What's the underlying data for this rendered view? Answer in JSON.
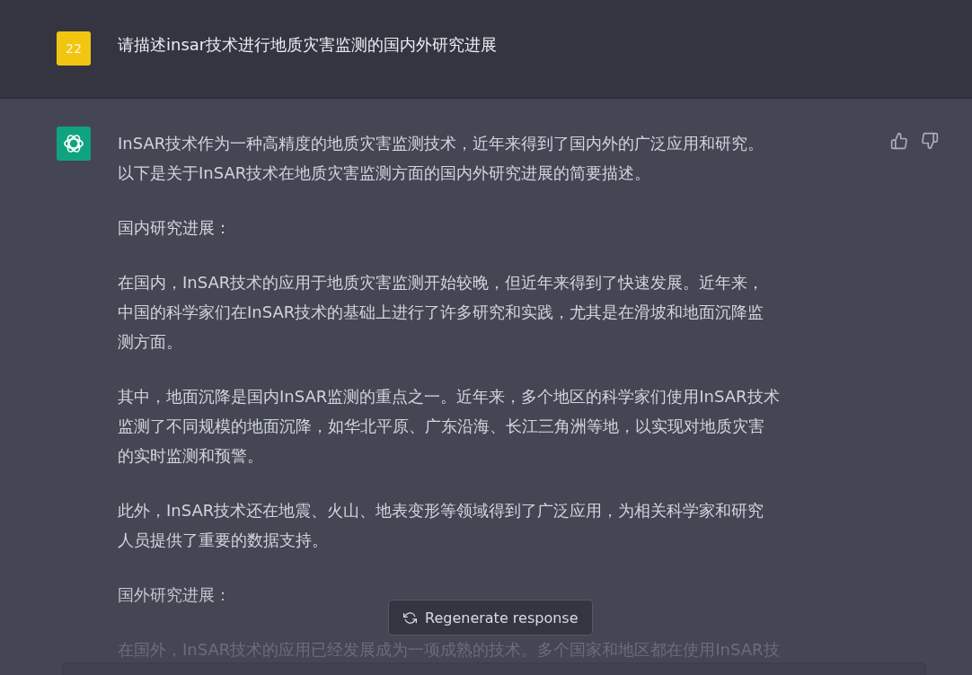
{
  "question": {
    "avatar": "22",
    "text": "请描述insar技术进行地质灾害监测的国内外研究进展"
  },
  "answer": {
    "paragraphs": [
      {
        "lines": [
          "InSAR技术作为一种高精度的地质灾害监测技术，近年来得到了国内外的广泛应用和研究。",
          "以下是关于InSAR技术在地质灾害监测方面的国内外研究进展的简要描述。"
        ],
        "faded": false
      },
      {
        "lines": [
          "国内研究进展："
        ],
        "faded": false
      },
      {
        "lines": [
          "在国内，InSAR技术的应用于地质灾害监测开始较晚，但近年来得到了快速发展。近年来，",
          "中国的科学家们在InSAR技术的基础上进行了许多研究和实践，尤其是在滑坡和地面沉降监",
          "测方面。"
        ],
        "faded": false
      },
      {
        "lines": [
          "其中，地面沉降是国内InSAR监测的重点之一。近年来，多个地区的科学家们使用InSAR技术",
          "监测了不同规模的地面沉降，如华北平原、广东沿海、长江三角洲等地，以实现对地质灾害",
          "的实时监测和预警。"
        ],
        "faded": false
      },
      {
        "lines": [
          "此外，InSAR技术还在地震、火山、地表变形等领域得到了广泛应用，为相关科学家和研究",
          "人员提供了重要的数据支持。"
        ],
        "faded": false
      },
      {
        "lines": [
          "国外研究进展："
        ],
        "faded": false
      },
      {
        "lines": [
          "在国外，InSAR技术的应用已经发展成为一项成熟的技术。多个国家和地区都在使用InSAR技"
        ],
        "faded": true
      }
    ]
  },
  "regenerate_button": {
    "label": "Regenerate response"
  }
}
